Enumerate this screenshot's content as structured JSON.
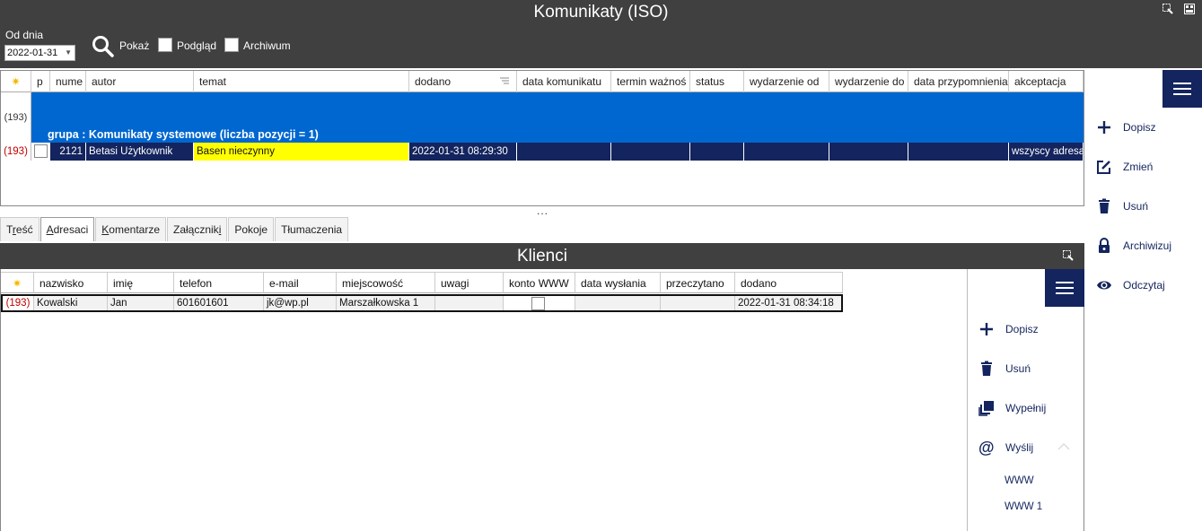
{
  "window": {
    "title": "Komunikaty (ISO)",
    "icon_names": [
      "select-region-icon",
      "layout-icon"
    ]
  },
  "filter": {
    "od_dnia_label": "Od dnia",
    "date_value": "2022-01-31",
    "pokaz_label": "Pokaż",
    "podglad_label": "Podgląd",
    "archiwum_label": "Archiwum"
  },
  "grid1": {
    "columns": [
      "p",
      "nume",
      "autor",
      "temat",
      "dodano",
      "data komunikatu",
      "termin ważnoś",
      "status",
      "wydarzenie od",
      "wydarzenie do",
      "data przypomnienia",
      "akceptacja"
    ],
    "group_count": "(193)",
    "group_label": "grupa : Komunikaty systemowe (liczba pozycji = 1)",
    "row": {
      "count": "(193)",
      "numer": "2121",
      "autor": "Betasi Użytkownik",
      "temat": "Basen nieczynny",
      "dodano": "2022-01-31 08:29:30",
      "akceptacja": "wszyscy adresaci"
    }
  },
  "actions_top": {
    "dopisz": "Dopisz",
    "zmien": "Zmień",
    "usun": "Usuń",
    "archiwizuj": "Archiwizuj",
    "odczytaj": "Odczytaj"
  },
  "splitter_label": "...",
  "tabs": [
    {
      "pre": "T",
      "u": "r",
      "post": "eść"
    },
    {
      "pre": "",
      "u": "A",
      "post": "dresaci"
    },
    {
      "pre": "",
      "u": "K",
      "post": "omentarze"
    },
    {
      "pre": "Załącznik",
      "u": "i",
      "post": ""
    },
    {
      "pre": "Pokoje",
      "u": "",
      "post": ""
    },
    {
      "pre": "Tłumaczenia",
      "u": "",
      "post": ""
    }
  ],
  "klienci": {
    "title": "Klienci",
    "columns": [
      "nazwisko",
      "imię",
      "telefon",
      "e-mail",
      "miejscowość",
      "uwagi",
      "konto WWW",
      "data wysłania",
      "przeczytano",
      "dodano"
    ],
    "row": {
      "count": "(193)",
      "nazwisko": "Kowalski",
      "imie": "Jan",
      "telefon": "601601601",
      "email": "jk@wp.pl",
      "miejscowosc": "Marszałkowska 1",
      "uwagi": "",
      "data_wyslania": "",
      "przeczytano": "",
      "dodano": "2022-01-31 08:34:18"
    }
  },
  "actions_bottom": {
    "dopisz": "Dopisz",
    "usun": "Usuń",
    "wypelnij": "Wypełnij",
    "wyslij": "Wyślij",
    "www": "WWW",
    "www1": "WWW 1"
  },
  "colors": {
    "navy": "#13245e",
    "group_blue": "#0067d0",
    "highlight_yellow": "#ffff00",
    "dark_bar": "#404040"
  }
}
